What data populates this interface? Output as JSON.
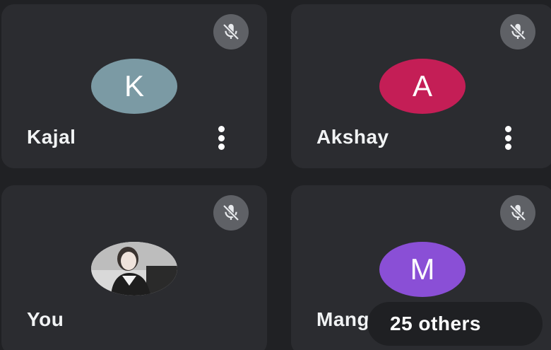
{
  "participants": [
    {
      "name": "Kajal",
      "initial": "K",
      "avatar_color": "#7b9aa4",
      "muted": true
    },
    {
      "name": "Akshay",
      "initial": "A",
      "avatar_color": "#c41e56",
      "muted": true
    },
    {
      "name": "You",
      "initial": "",
      "muted": true
    },
    {
      "name": "Mangesh",
      "visible_name": "Mang",
      "initial": "M",
      "avatar_color": "#8a4fd6",
      "muted": true
    }
  ],
  "others_badge": {
    "label": "25 others"
  },
  "colors": {
    "background": "#202124",
    "tile": "#2b2c30",
    "mute_button": "#5f6166"
  },
  "icons": {
    "mute": "mic-off-icon",
    "more": "more-vert-icon"
  }
}
